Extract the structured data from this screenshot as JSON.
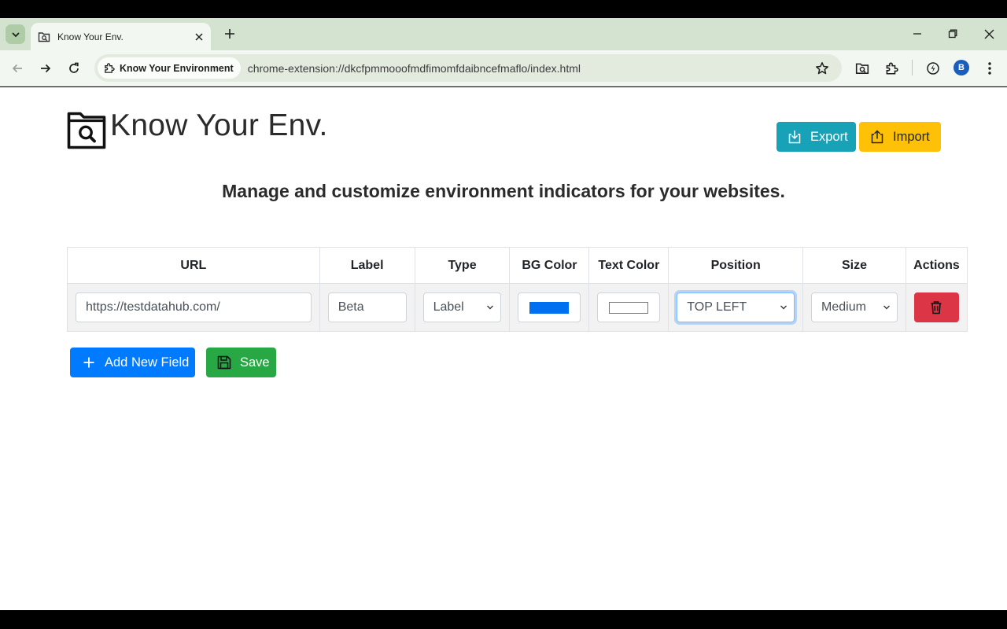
{
  "browser": {
    "tab_title": "Know Your Env.",
    "site_chip": "Know Your Environment",
    "url": "chrome-extension://dkcfpmmooofmdfimomfdaibncefmaflo/index.html",
    "avatar_letter": "B"
  },
  "header": {
    "title": "Know Your Env.",
    "export_label": "Export",
    "import_label": "Import",
    "subtitle": "Manage and customize environment indicators for your websites."
  },
  "table": {
    "columns": [
      "URL",
      "Label",
      "Type",
      "BG Color",
      "Text Color",
      "Position",
      "Size",
      "Actions"
    ],
    "rows": [
      {
        "url": "https://testdatahub.com/",
        "label": "Beta",
        "type": "Label",
        "bg_color": "#0070f0",
        "text_color": "#ffffff",
        "position": "TOP LEFT",
        "size": "Medium"
      }
    ]
  },
  "actions": {
    "add_label": "Add New Field",
    "save_label": "Save"
  },
  "colors": {
    "export": "#17a2b8",
    "import": "#ffc107",
    "add": "#007bff",
    "save": "#28a745",
    "delete": "#dc3545"
  }
}
